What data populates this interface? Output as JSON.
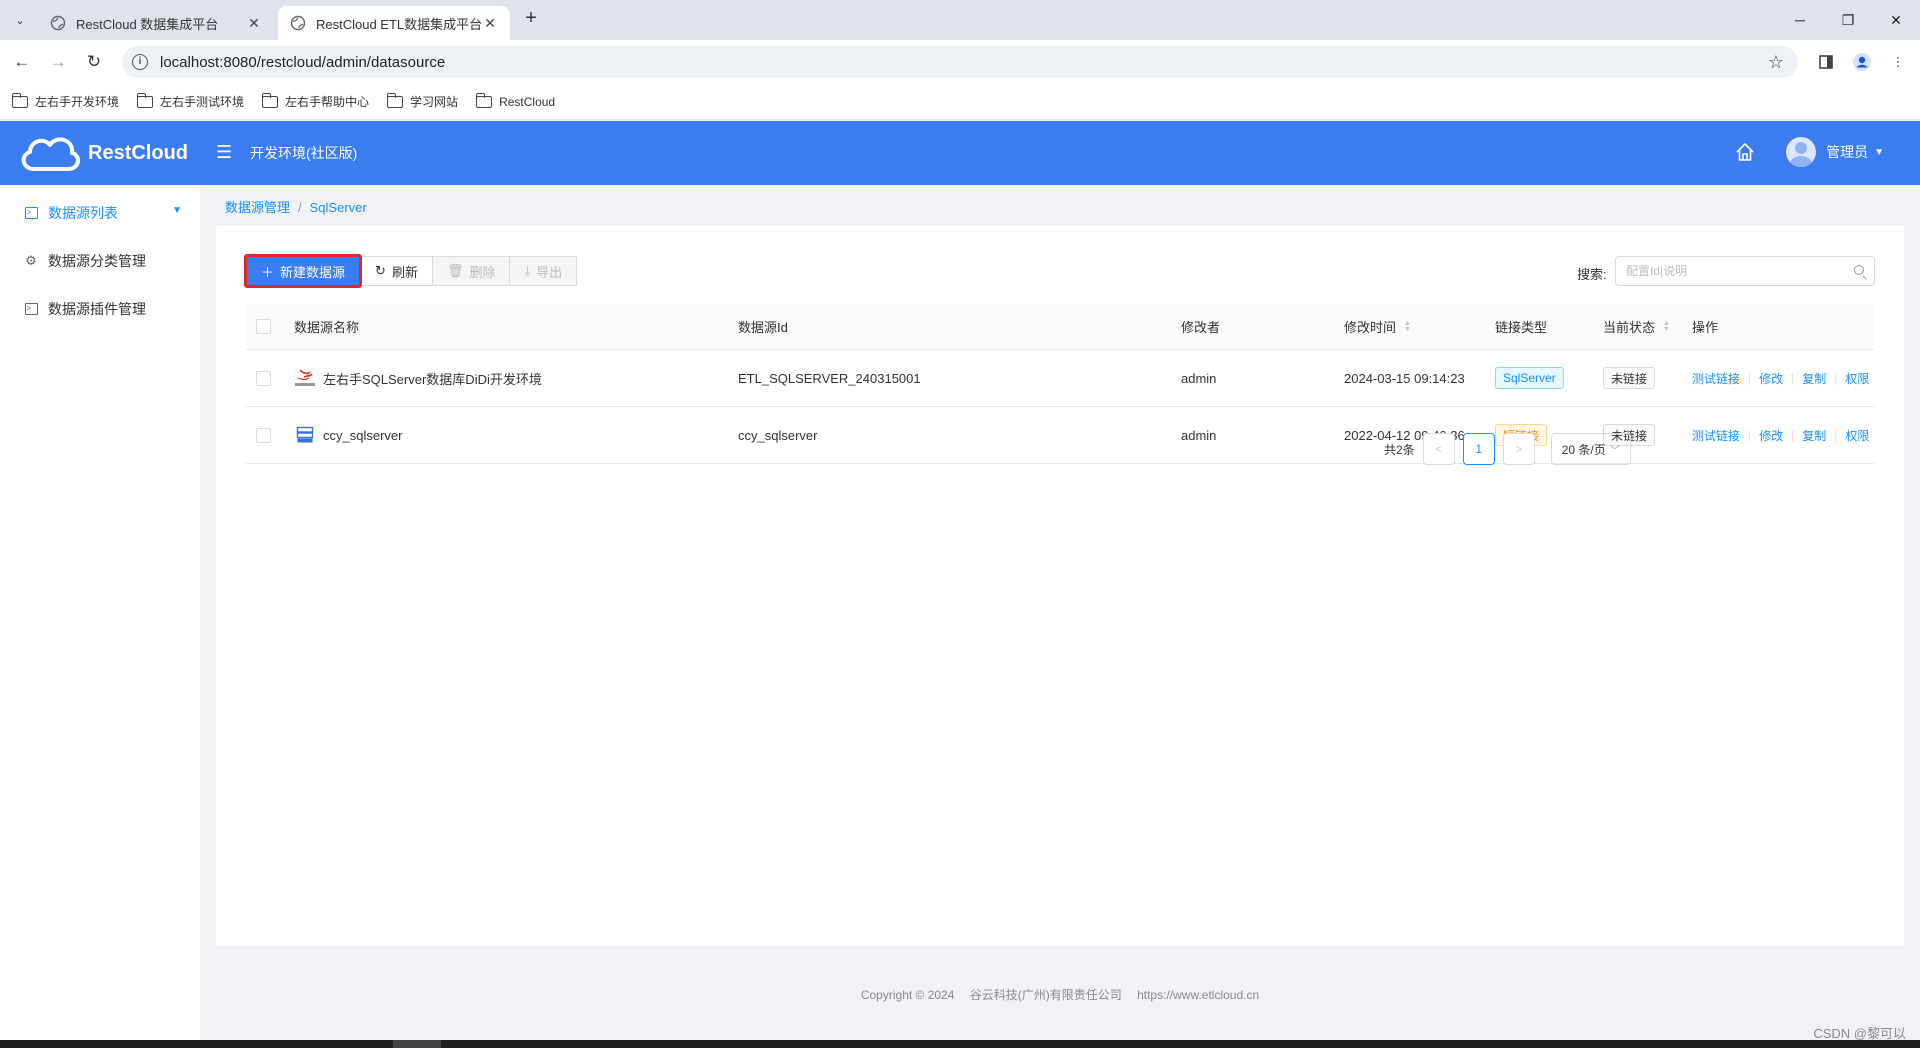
{
  "browser": {
    "tabs": [
      {
        "title": "RestCloud 数据集成平台",
        "active": false
      },
      {
        "title": "RestCloud ETL数据集成平台",
        "active": true
      }
    ],
    "url": "localhost:8080/restcloud/admin/datasource",
    "bookmarks": [
      "左右手开发环境",
      "左右手测试环境",
      "左右手帮助中心",
      "学习网站",
      "RestCloud"
    ]
  },
  "header": {
    "brand": "RestCloud",
    "env_title": "开发环境(社区版)",
    "user_name": "管理员",
    "brand_color": "#3b7cf0"
  },
  "sidebar": {
    "items": [
      {
        "label": "数据源列表",
        "icon": "terminal-icon",
        "active": true
      },
      {
        "label": "数据源分类管理",
        "icon": "gear-icon",
        "active": false
      },
      {
        "label": "数据源插件管理",
        "icon": "terminal-icon",
        "active": false
      }
    ]
  },
  "breadcrumb": {
    "root": "数据源管理",
    "separator": "/",
    "current": "SqlServer"
  },
  "toolbar": {
    "new_label": "新建数据源",
    "refresh_label": "刷新",
    "delete_label": "删除",
    "export_label": "导出",
    "search_label": "搜索:",
    "search_placeholder": "配置Id|说明",
    "search_value": ""
  },
  "table": {
    "columns": {
      "name": "数据源名称",
      "id": "数据源Id",
      "modifier": "修改者",
      "modified_time": "修改时间",
      "link_type": "链接类型",
      "status": "当前状态",
      "ops": "操作"
    },
    "rows": [
      {
        "name": "左右手SQLServer数据库DiDi开发环境",
        "icon": "sqlserver-logo-icon",
        "id": "ETL_SQLSERVER_240315001",
        "modifier": "admin",
        "modified_time": "2024-03-15 09:14:23",
        "link_type": "SqlServer",
        "link_type_color": "blue",
        "status": "未链接"
      },
      {
        "name": "ccy_sqlserver",
        "icon": "database-icon",
        "id": "ccy_sqlserver",
        "modifier": "admin",
        "modified_time": "2022-04-12 09:40:36",
        "link_type": "短链接",
        "link_type_color": "orange",
        "status": "未链接"
      }
    ],
    "ops": [
      "测试链接",
      "修改",
      "复制",
      "权限"
    ]
  },
  "pagination": {
    "total": "共2条",
    "current_page": "1",
    "page_size": "20 条/页"
  },
  "footer": {
    "copyright": "Copyright © 2024",
    "company": "谷云科技(广州)有限责任公司",
    "website": "https://www.etlcloud.cn"
  },
  "watermark": "CSDN @黎可以"
}
